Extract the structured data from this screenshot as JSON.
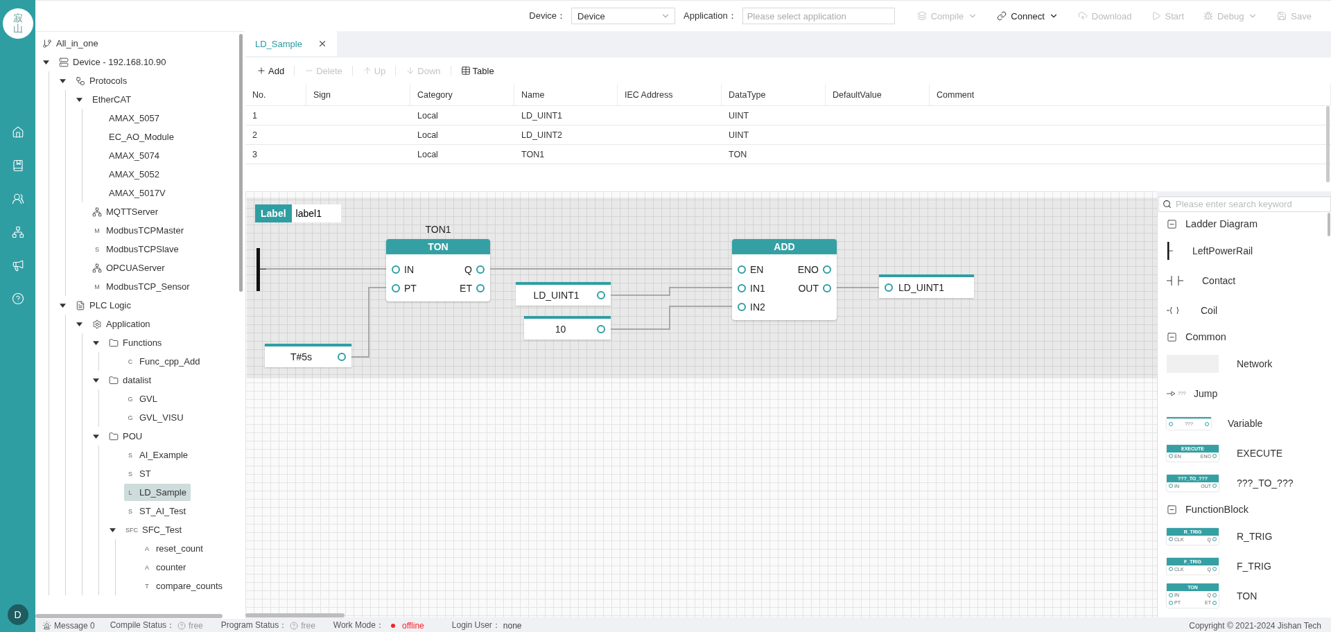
{
  "app": {
    "logo_text": "寂山",
    "avatar": "D"
  },
  "toolbar": {
    "device": {
      "label": "Device：",
      "value": "Device"
    },
    "application": {
      "label": "Application：",
      "placeholder": "Please select application"
    },
    "actions": [
      {
        "kind": "compile",
        "label": "Compile",
        "disabled": true,
        "dropdown": true
      },
      {
        "kind": "connect",
        "label": "Connect",
        "disabled": false,
        "dropdown": true
      },
      {
        "kind": "download",
        "label": "Download",
        "disabled": true,
        "dropdown": false
      },
      {
        "kind": "start",
        "label": "Start",
        "disabled": true,
        "dropdown": false
      },
      {
        "kind": "debug",
        "label": "Debug",
        "disabled": true,
        "dropdown": true
      },
      {
        "kind": "save",
        "label": "Save",
        "disabled": true,
        "dropdown": false
      }
    ]
  },
  "tree": {
    "label": "All_in_one",
    "kind": "branch",
    "selected": false,
    "children": [
      {
        "label": "Device - 192.168.10.90",
        "kind": "device",
        "selected": false,
        "expanded": true,
        "children": [
          {
            "label": "Protocols",
            "kind": "protocols",
            "selected": false,
            "expanded": true,
            "children": [
              {
                "label": "EtherCAT",
                "selected": false,
                "expanded": true,
                "children": [
                  {
                    "label": "AMAX_5057",
                    "selected": false
                  },
                  {
                    "label": "EC_AO_Module",
                    "selected": false
                  },
                  {
                    "label": "AMAX_5074",
                    "selected": false
                  },
                  {
                    "label": "AMAX_5052",
                    "selected": false
                  },
                  {
                    "label": "AMAX_5017V",
                    "selected": false
                  }
                ]
              },
              {
                "label": "MQTTServer",
                "kind": "server",
                "selected": false
              },
              {
                "label": "ModbusTCPMaster",
                "badge": "M",
                "selected": false
              },
              {
                "label": "ModbusTCPSlave",
                "badge": "S",
                "selected": false
              },
              {
                "label": "OPCUAServer",
                "kind": "server",
                "selected": false
              },
              {
                "label": "ModbusTCP_Sensor",
                "badge": "M",
                "selected": false
              }
            ]
          },
          {
            "label": "PLC Logic",
            "kind": "file",
            "selected": false,
            "expanded": true,
            "children": [
              {
                "label": "Application",
                "kind": "gear",
                "selected": false,
                "expanded": true,
                "children": [
                  {
                    "label": "Functions",
                    "kind": "folder",
                    "selected": false,
                    "expanded": true,
                    "children": [
                      {
                        "label": "Func_cpp_Add",
                        "badge": "C",
                        "selected": false
                      }
                    ]
                  },
                  {
                    "label": "datalist",
                    "kind": "folder",
                    "selected": false,
                    "expanded": true,
                    "children": [
                      {
                        "label": "GVL",
                        "badge": "G",
                        "selected": false
                      },
                      {
                        "label": "GVL_VISU",
                        "badge": "G",
                        "selected": false
                      }
                    ]
                  },
                  {
                    "label": "POU",
                    "kind": "folder",
                    "selected": false,
                    "expanded": true,
                    "children": [
                      {
                        "label": "AI_Example",
                        "badge": "S",
                        "selected": false
                      },
                      {
                        "label": "ST",
                        "badge": "S",
                        "selected": false
                      },
                      {
                        "label": "LD_Sample",
                        "badge": "L",
                        "selected": true
                      },
                      {
                        "label": "ST_AI_Test",
                        "badge": "S",
                        "selected": false
                      },
                      {
                        "label": "SFC_Test",
                        "badge": "SFC",
                        "selected": false,
                        "expanded": true,
                        "children": [
                          {
                            "label": "reset_count",
                            "badge": "A",
                            "selected": false
                          },
                          {
                            "label": "counter",
                            "badge": "A",
                            "selected": false
                          },
                          {
                            "label": "compare_counts",
                            "badge": "T",
                            "selected": false
                          }
                        ]
                      }
                    ]
                  }
                ]
              }
            ]
          }
        ]
      }
    ]
  },
  "tabs": [
    {
      "label": "LD_Sample",
      "selected": true
    }
  ],
  "table_toolbar": [
    {
      "kind": "add",
      "label": "Add",
      "disabled": false
    },
    {
      "kind": "delete",
      "label": "Delete",
      "disabled": true
    },
    {
      "kind": "up",
      "label": "Up",
      "disabled": true
    },
    {
      "kind": "down",
      "label": "Down",
      "disabled": true
    },
    {
      "kind": "table",
      "label": "Table",
      "disabled": false
    }
  ],
  "table": {
    "columns": [
      "No.",
      "Sign",
      "Category",
      "Name",
      "IEC Address",
      "DataType",
      "DefaultValue",
      "Comment"
    ],
    "rows": [
      [
        "1",
        null,
        "Local",
        "LD_UINT1",
        null,
        "UINT",
        null,
        null
      ],
      [
        "2",
        null,
        "Local",
        "LD_UINT2",
        null,
        "UINT",
        null,
        null
      ],
      [
        "3",
        null,
        "Local",
        "TON1",
        null,
        "TON",
        null,
        null
      ]
    ]
  },
  "diagram": {
    "label": {
      "tag": "Label",
      "value": "label1"
    },
    "blocks": [
      {
        "instance": "TON1",
        "type": "TON",
        "inputs": [
          "IN",
          "PT"
        ],
        "outputs": [
          "Q",
          "ET"
        ]
      },
      {
        "type": "ADD",
        "inputs": [
          "EN",
          "IN1",
          "IN2"
        ],
        "outputs": [
          "ENO",
          "OUT"
        ]
      }
    ],
    "variables": [
      {
        "name": "LD_UINT1",
        "kind": "input"
      },
      {
        "name": "10",
        "kind": "input"
      },
      {
        "name": "T#5s",
        "kind": "input"
      },
      {
        "name": "LD_UINT1",
        "kind": "output"
      }
    ]
  },
  "palette": {
    "search": {
      "placeholder": "Please enter search keyword"
    },
    "groups": [
      {
        "title": "Ladder Diagram",
        "expanded": true,
        "items": [
          {
            "label": "LeftPowerRail",
            "kind": "rail"
          },
          {
            "label": "Contact",
            "kind": "contact"
          },
          {
            "label": "Coil",
            "kind": "coil"
          }
        ]
      },
      {
        "title": "Common",
        "expanded": true,
        "items": [
          {
            "label": "Network",
            "kind": "network"
          },
          {
            "label": "Jump",
            "kind": "jump",
            "preview_text": "???"
          },
          {
            "label": "Variable",
            "kind": "variable",
            "preview_text": "???"
          },
          {
            "label": "EXECUTE",
            "kind": "block",
            "preview": {
              "title": "EXECUTE",
              "inputs": [
                "EN"
              ],
              "outputs": [
                "ENO"
              ]
            }
          },
          {
            "label": "???_TO_???",
            "kind": "block",
            "preview": {
              "title": "???_TO_???",
              "inputs": [
                "IN"
              ],
              "outputs": [
                "OUT"
              ]
            }
          }
        ]
      },
      {
        "title": "FunctionBlock",
        "expanded": true,
        "items": [
          {
            "label": "R_TRIG",
            "kind": "block",
            "preview": {
              "title": "R_TRIG",
              "inputs": [
                "CLK"
              ],
              "outputs": [
                "Q"
              ]
            }
          },
          {
            "label": "F_TRIG",
            "kind": "block",
            "preview": {
              "title": "F_TRIG",
              "inputs": [
                "CLK"
              ],
              "outputs": [
                "Q"
              ]
            }
          },
          {
            "label": "TON",
            "kind": "block",
            "preview": {
              "title": "TON",
              "inputs": [
                "IN",
                "PT"
              ],
              "outputs": [
                "Q",
                "ET"
              ]
            }
          }
        ]
      }
    ]
  },
  "status": {
    "message": "Message 0",
    "compile": {
      "label": "Compile Status：",
      "value": "free"
    },
    "program": {
      "label": "Program Status：",
      "value": "free"
    },
    "work_mode": {
      "label": "Work Mode：",
      "value": "offline",
      "online": false
    },
    "login": {
      "label": "Login User：",
      "value": "none"
    },
    "copyright": "Copyright © 2021-2024 Jishan Tech"
  }
}
